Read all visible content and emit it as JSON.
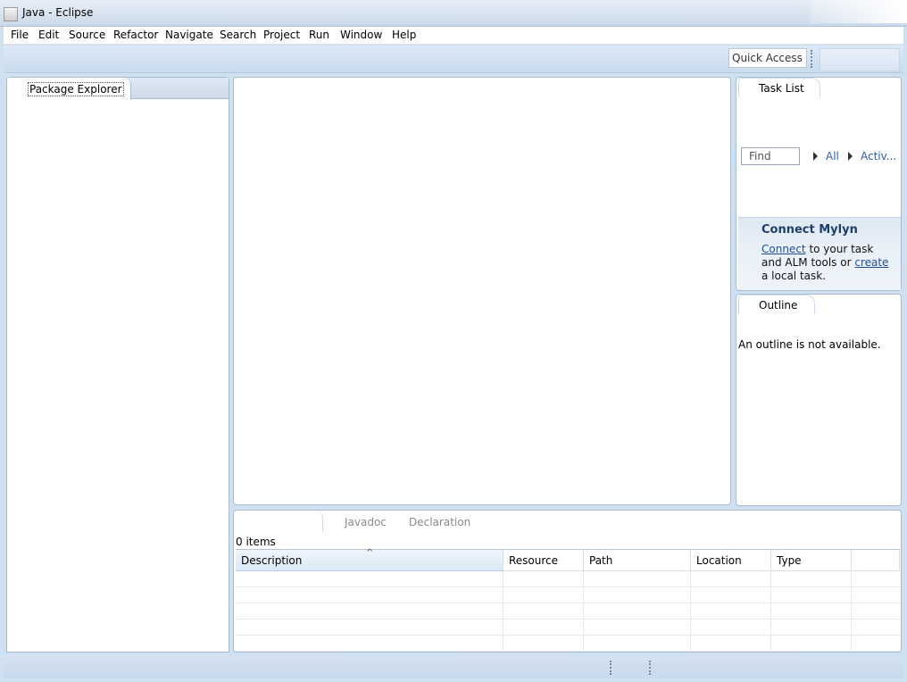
{
  "window": {
    "title": "Java - Eclipse"
  },
  "menu": [
    "File",
    "Edit",
    "Source",
    "Refactor",
    "Navigate",
    "Search",
    "Project",
    "Run",
    "Window",
    "Help"
  ],
  "toolbar": {
    "quick_access": "Quick Access"
  },
  "package_explorer": {
    "tab": "Package Explorer"
  },
  "task_list": {
    "tab": "Task List",
    "find_placeholder": "Find",
    "filter_all": "All",
    "filter_active": "Activ...",
    "mylyn": {
      "title": "Connect Mylyn",
      "connect_link": "Connect",
      "text1": " to your task and ALM tools or ",
      "create_link": "create",
      "text2": " a local task."
    }
  },
  "outline": {
    "tab": "Outline",
    "message": "An outline is not available."
  },
  "bottom": {
    "tabs": [
      "Javadoc",
      "Declaration"
    ],
    "items_count": "0 items",
    "columns": [
      "Description",
      "Resource",
      "Path",
      "Location",
      "Type"
    ]
  }
}
